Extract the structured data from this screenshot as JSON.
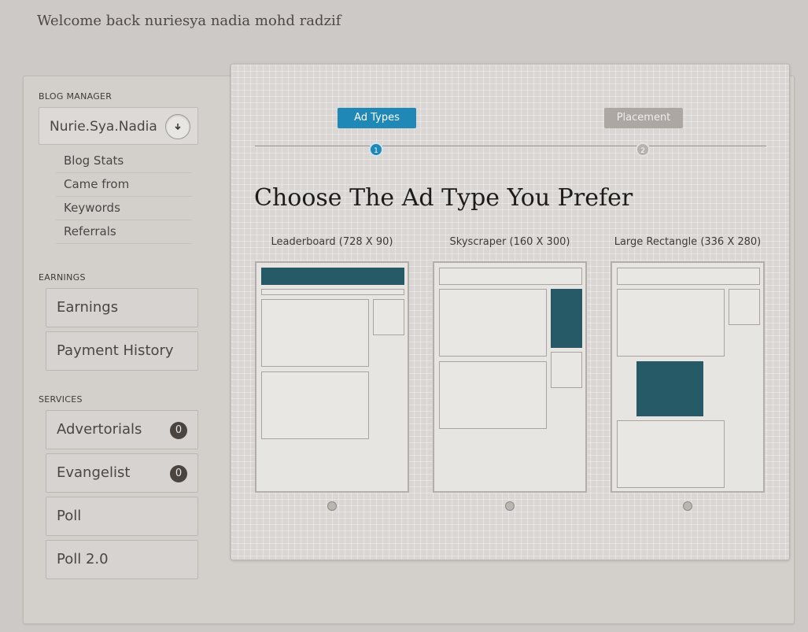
{
  "welcome": "Welcome back nuriesya nadia mohd radzif",
  "sidebar": {
    "blog_manager_title": "BLOG MANAGER",
    "blog_name": "Nurie.Sya.Nadia",
    "blog_items": [
      "Blog Stats",
      "Came from",
      "Keywords",
      "Referrals"
    ],
    "earnings_title": "EARNINGS",
    "earnings_items": [
      "Earnings",
      "Payment History"
    ],
    "services_title": "SERVICES",
    "services_items": [
      {
        "label": "Advertorials",
        "badge": "0"
      },
      {
        "label": "Evangelist",
        "badge": "0"
      },
      {
        "label": "Poll"
      },
      {
        "label": "Poll 2.0"
      }
    ]
  },
  "wizard": {
    "steps": [
      {
        "label": "Ad Types",
        "number": "1",
        "active": true
      },
      {
        "label": "Placement",
        "number": "2",
        "active": false
      }
    ],
    "headline": "Choose The Ad Type You Prefer",
    "ad_types": [
      {
        "label": "Leaderboard (728 X 90)"
      },
      {
        "label": "Skyscraper (160 X 300)"
      },
      {
        "label": "Large Rectangle (336 X 280)"
      }
    ]
  },
  "colors": {
    "accent": "#1f88b6",
    "ad_block": "#255a66",
    "inactive_step": "#aca7a3"
  }
}
